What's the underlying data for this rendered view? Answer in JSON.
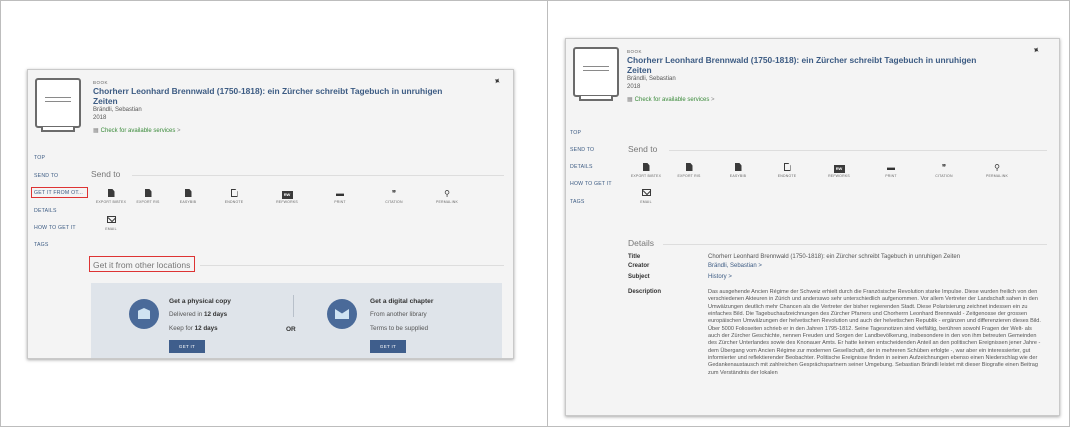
{
  "record": {
    "type": "BOOK",
    "title_line1": "Chorherr Leonhard Brennwald (1750-1818): ein Zürcher schreibt Tagebuch in unruhigen",
    "title_line2": "Zeiten",
    "author": "Brändli, Sebastian",
    "year": "2018",
    "availability": "Check for available services",
    "availability_arrow": ">",
    "pin_icon": "pin-icon"
  },
  "left_panel": {
    "nav": [
      "TOP",
      "SEND TO",
      "GET IT FROM OT...",
      "DETAILS",
      "HOW TO GET IT",
      "TAGS"
    ],
    "send_to": "Send to",
    "actions": [
      "EXPORT BIBTEX",
      "EXPORT RIS",
      "EASYBIB",
      "ENDNOTE",
      "REFWORKS",
      "PRINT",
      "CITATION",
      "PERMALINK",
      "EMAIL"
    ],
    "get_it_heading": "Get it from other locations",
    "physical": {
      "title": "Get a physical copy",
      "line1_prefix": "Delivered in ",
      "line1_value": "12 days",
      "line2_prefix": "Keep for ",
      "line2_value": "12 days",
      "button": "GET IT"
    },
    "or": "OR",
    "digital": {
      "title": "Get a digital chapter",
      "line1": "From another library",
      "line2": "Terms to be supplied",
      "button": "GET IT"
    }
  },
  "right_panel": {
    "nav": [
      "TOP",
      "SEND TO",
      "DETAILS",
      "HOW TO GET IT",
      "TAGS"
    ],
    "send_to": "Send to",
    "actions": [
      "EXPORT BIBTEX",
      "EXPORT RIS",
      "EASYBIB",
      "ENDNOTE",
      "REFWORKS",
      "PRINT",
      "CITATION",
      "PERMALINK",
      "EMAIL"
    ],
    "details_heading": "Details",
    "fields": {
      "title_label": "Title",
      "title_value": "Chorherr Leonhard Brennwald (1750-1818): ein Zürcher schreibt Tagebuch in unruhigen Zeiten",
      "creator_label": "Creator",
      "creator_value": "Brändli, Sebastian >",
      "subject_label": "Subject",
      "subject_value": "History >",
      "description_label": "Description"
    },
    "description": "Das ausgehende Ancien Régime der Schweiz erhielt durch die Französische Revolution starke Impulse. Diese wurden freilich von den verschiedenen Akteuren in Zürich und andersswo sehr unterschiedlich aufgenommen. Vor allem Vertreter der Landschaft sahen in den Umwälzungen deutlich mehr Chancen als die Vertreter der bisher regierenden Stadt. Diese Polarisierung zeichnet indessen ein zu einfaches Bild. Die Tagebuchaufzeichnungen des Zürcher Pfarrers und Chorherrn Leonhard Brennwald - Zeitgenosse der grossen europäischen Umwälzungen der helvetischen Revolution und auch der helvetischen Republik - ergänzen und differenzieren dieses Bild. Über 5000 Folioseiten schrieb er in den Jahren 1795-1812. Seine Tagesnotizen sind vielfältig, berühren sowohl Fragen der Welt- als auch der Zürcher Geschichte, nennen Freuden und Sorgen der Landbevölkerung, insbesondere in den von ihm betreuten Gemeinden des Zürcher Unterlandes sowie des Knonauer Amts. Er hatte keinen entscheidenden Anteil an den politischen Ereignissen jener Jahre - dem Übergang vom Ancien Régime zur modernen Gesellschaft, der in mehreren Schüben erfolgte -, war aber ein interessierter, gut informierter und reflektierender Beobachter. Politische Ereignisse finden in seinen Aufzeichnungen ebenso einen Niederschlag wie der Gedankenaustausch mit zahlreichen Gesprächspartnern seiner Umgebung. Sebastian Brändli leistet mit dieser Biografie einen Beitrag zum Verständnis der lokalen"
  }
}
